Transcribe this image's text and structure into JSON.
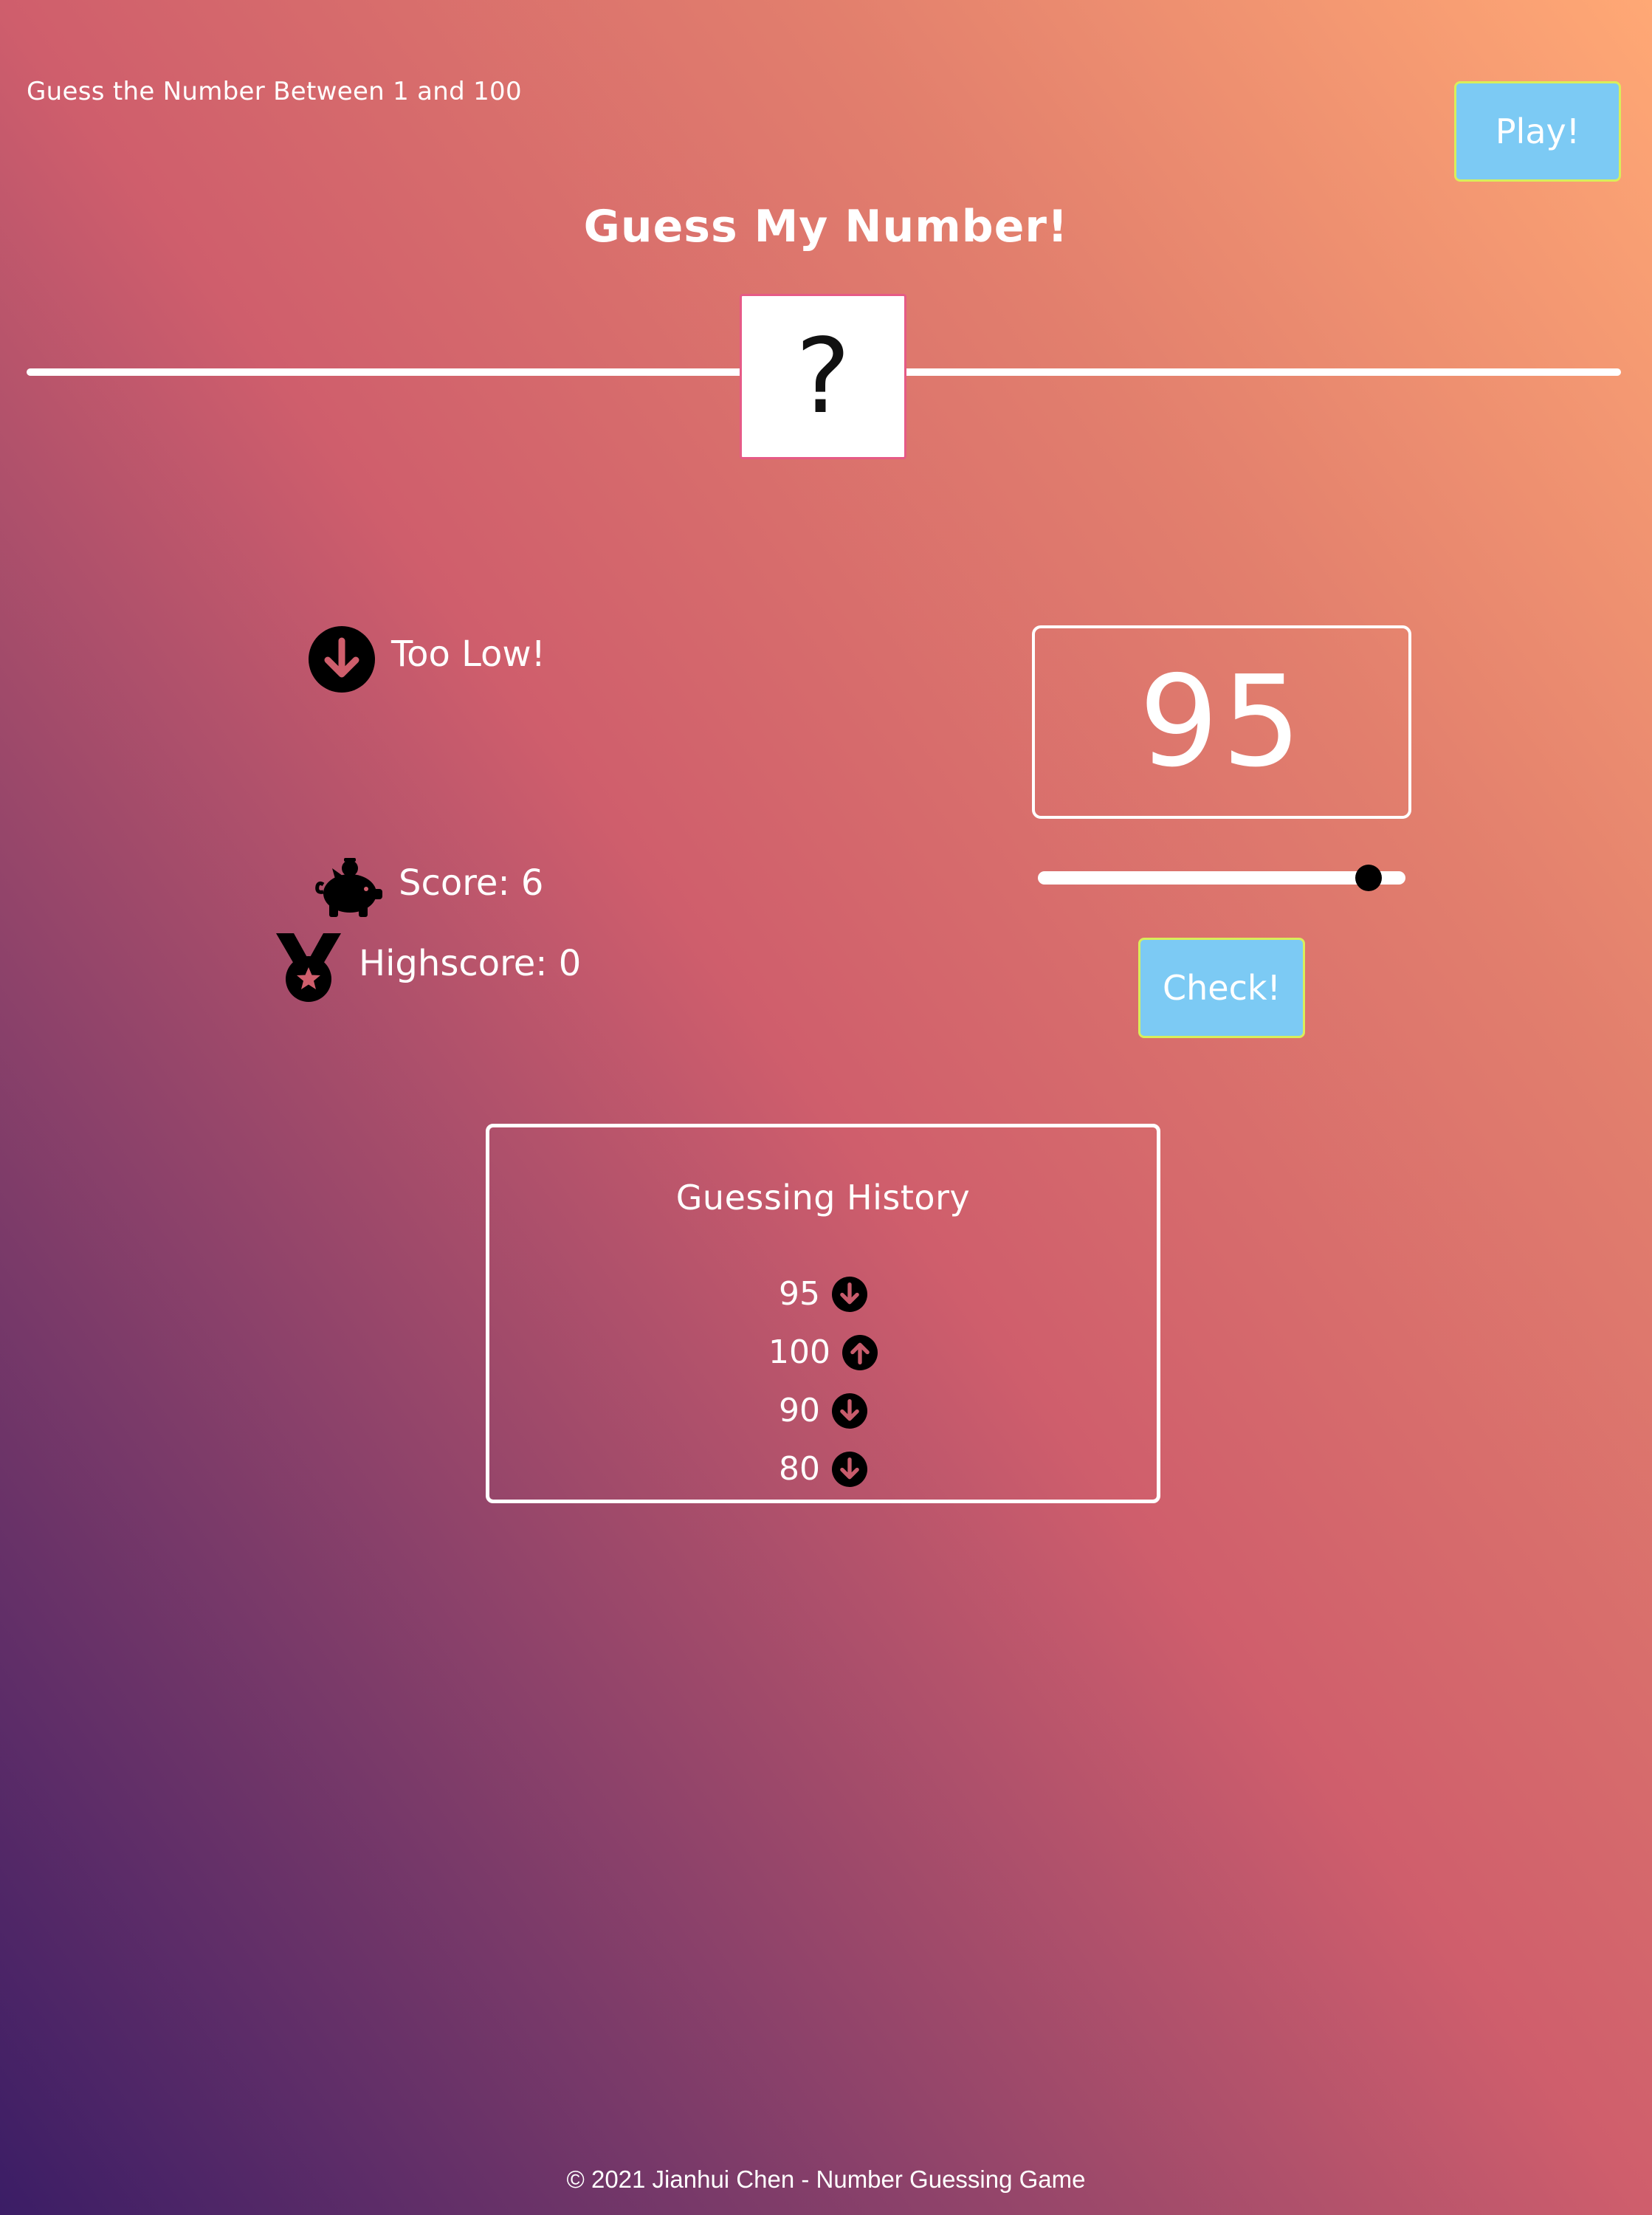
{
  "header": {
    "subtitle": "Guess the Number Between 1 and 100",
    "play_label": "Play!",
    "title": "Guess My Number!"
  },
  "secret": {
    "display": "?"
  },
  "status": {
    "message": "Too Low!",
    "message_icon": "arrow-down-circle-icon",
    "score_label": "Score: 6",
    "score_icon": "piggy-bank-icon",
    "highscore_label": "Highscore: 0",
    "highscore_icon": "medal-icon"
  },
  "guess": {
    "value": "95",
    "slider_value": 95,
    "slider_min": 1,
    "slider_max": 100,
    "check_label": "Check!"
  },
  "history": {
    "title": "Guessing History",
    "items": [
      {
        "value": "95",
        "icon": "arrow-down-circle-icon"
      },
      {
        "value": "100",
        "icon": "arrow-up-circle-icon"
      },
      {
        "value": "90",
        "icon": "arrow-down-circle-icon"
      },
      {
        "value": "80",
        "icon": "arrow-down-circle-icon"
      }
    ]
  },
  "footer": {
    "text": "© 2021 Jianhui Chen - Number Guessing Game"
  },
  "colors": {
    "button_bg": "#7ccaf4",
    "button_border": "#d9ee5a",
    "gradient_top_right": "#ffa875",
    "gradient_mid": "#cf5e6c",
    "gradient_bottom_left": "#3b1d66"
  }
}
